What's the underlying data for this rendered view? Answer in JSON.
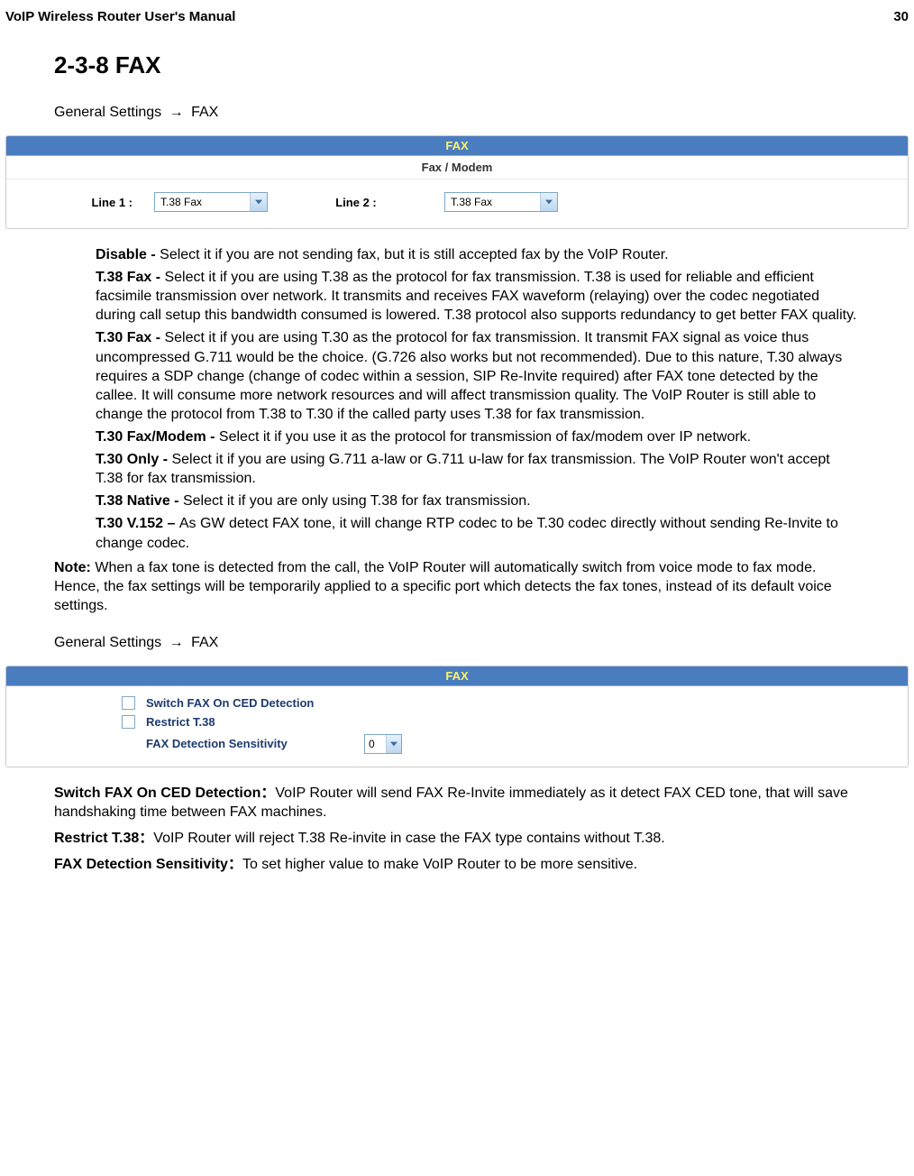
{
  "header": {
    "left": "VoIP Wireless Router User's Manual",
    "right": "30"
  },
  "heading": "2-3-8 FAX",
  "breadcrumb1": {
    "a": "General Settings",
    "sep": "→",
    "b": "FAX"
  },
  "panel1": {
    "title": "FAX",
    "subtitle": "Fax / Modem",
    "line1_label": "Line 1 :",
    "line1_value": "T.38 Fax",
    "line2_label": "Line 2 :",
    "line2_value": "T.38 Fax"
  },
  "defs": {
    "disable_t": "Disable - ",
    "disable_b": "Select it if you are not sending fax, but it is still accepted fax by the VoIP Router.",
    "t38fax_t": "T.38 Fax - ",
    "t38fax_b": "Select it if you are using T.38 as the protocol for fax transmission. T.38 is used for reliable and efficient facsimile transmission over network. It transmits and receives FAX waveform (relaying) over the codec negotiated during call setup this bandwidth consumed is lowered. T.38 protocol also supports redundancy to get better FAX quality.",
    "t30fax_t": "T.30 Fax - ",
    "t30fax_b": "Select it if you are using T.30 as the protocol for fax transmission. It transmit FAX signal as voice thus uncompressed G.711 would be the choice. (G.726 also works but not recommended). Due to this nature, T.30 always requires a SDP change (change of codec within a session, SIP Re-Invite required) after FAX tone detected by the callee. It will consume more network resources and will affect transmission quality. The VoIP Router is still able to change the protocol from T.38 to T.30 if the called party uses T.38 for fax transmission.",
    "t30fm_t": "T.30 Fax/Modem - ",
    "t30fm_b": "Select it if you use it as the protocol for transmission of fax/modem over IP network.",
    "t30only_t": "T.30 Only - ",
    "t30only_b": "Select it if you are using G.711 a-law or G.711 u-law for fax transmission. The VoIP Router won't accept T.38 for fax transmission.",
    "t38native_t": "T.38 Native - ",
    "t38native_b": "Select it if you are only using T.38 for fax transmission.",
    "t30v152_t": "T.30 V.152 – ",
    "t30v152_b": "As GW detect FAX tone, it will change RTP codec to be T.30 codec directly without sending Re-Invite to change codec."
  },
  "note_t": "Note:",
  "note_b": " When a fax tone is detected from the call, the VoIP Router will automatically switch from voice mode to fax mode. Hence, the fax settings will be temporarily applied to a specific port which detects the fax tones, instead of its default voice settings.",
  "breadcrumb2": {
    "a": "General Settings",
    "sep": "→",
    "b": "FAX"
  },
  "panel2": {
    "title": "FAX",
    "ck1": "Switch FAX On CED Detection",
    "ck2": "Restrict T.38",
    "sens_label": "FAX Detection Sensitivity",
    "sens_value": "0"
  },
  "desc2": {
    "d1_t": "Switch FAX On CED Detection：",
    "d1_b": "VoIP Router will send FAX Re-Invite immediately as it detect FAX CED tone, that will save handshaking time between FAX machines.",
    "d2_t": "Restrict T.38：",
    "d2_b": "VoIP Router will reject T.38 Re-invite in case the FAX type contains without T.38.",
    "d3_t": "FAX Detection Sensitivity：",
    "d3_b": "To set higher value to make VoIP Router to be more sensitive."
  }
}
